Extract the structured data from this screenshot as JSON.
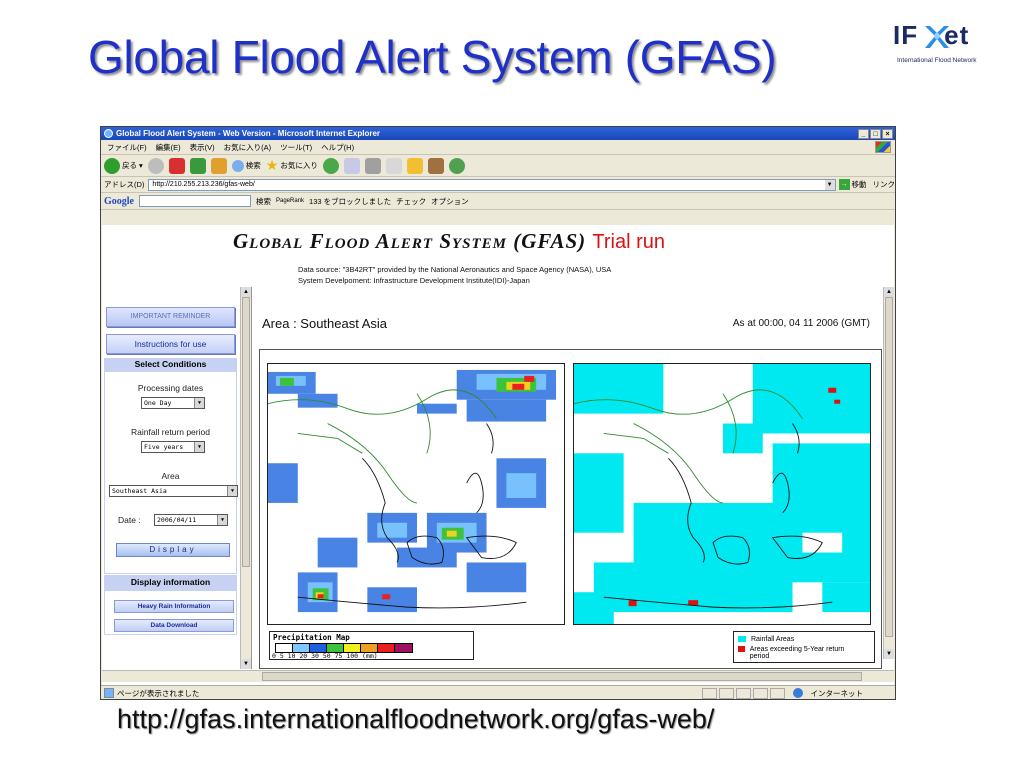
{
  "slide": {
    "title": "Global Flood Alert System (GFAS)",
    "url_caption": "http://gfas.internationalfloodnetwork.org/gfas-web/"
  },
  "logo": {
    "word_left": "IF",
    "word_right": "et",
    "subtitle": "International Flood Network"
  },
  "browser": {
    "title": "Global Flood Alert System - Web Version - Microsoft Internet Explorer",
    "window_controls": [
      "_",
      "□",
      "×"
    ],
    "menu": [
      "ファイル(F)",
      "編集(E)",
      "表示(V)",
      "お気に入り(A)",
      "ツール(T)",
      "ヘルプ(H)"
    ],
    "toolbar": {
      "back_label": "戻る",
      "search_label": "検索",
      "favorites_label": "お気に入り"
    },
    "address": {
      "label": "アドレス(D)",
      "value": "http://210.255.213.236/gfas-web/",
      "go_label": "移動",
      "links_label": "リンク"
    },
    "google_bar": {
      "logo": "Google",
      "search_label": "検索",
      "pagerank_label": "PageRank",
      "blocked_label": "133 をブロックしました",
      "check_label": "チェック",
      "options_label": "オプション"
    },
    "status": {
      "left": "ページが表示されました",
      "zone": "インターネット"
    }
  },
  "page": {
    "heading": "Global Flood Alert System (GFAS)",
    "trial": "Trial run",
    "source_line": "Data source: \"3B42RT\" provided by the National Aeronautics and Space Agency (NASA), USA",
    "development_line": "System Develpoment: Infrastructure Development Institute(IDI)-Japan",
    "sidebar": {
      "reminder_button": "IMPORTANT REMINDER",
      "instructions_button": "Instructions for use",
      "select_conditions": "Select Conditions",
      "processing_dates_label": "Processing dates",
      "processing_dates_value": "One Day",
      "return_period_label": "Rainfall return period",
      "return_period_value": "Five years",
      "area_label": "Area",
      "area_value": "Southeast Asia",
      "date_label": "Date :",
      "date_value": "2006/04/11",
      "display_button": "Display",
      "display_information": "Display information",
      "heavy_rain_button": "Heavy Rain Information",
      "data_download_button": "Data Download"
    },
    "main": {
      "area_title": "Area : Southeast Asia",
      "as_at": "As at 00:00, 04 11 2006 (GMT)",
      "precip_legend": {
        "title": "Precipitation Map",
        "colors": [
          "#ffffff",
          "#7ec8ff",
          "#2060e0",
          "#3cc23c",
          "#f0f020",
          "#f0a020",
          "#e82020",
          "#a01060"
        ],
        "ticks": "0   5   10  20  30  50  75  100 (mm)"
      },
      "flood_legend": {
        "rainfall_areas": "Rainfall Areas",
        "rainfall_color": "#00e8f0",
        "exceeding": "Areas exceeding 5-Year return period",
        "exceeding_color": "#e01010"
      }
    }
  }
}
